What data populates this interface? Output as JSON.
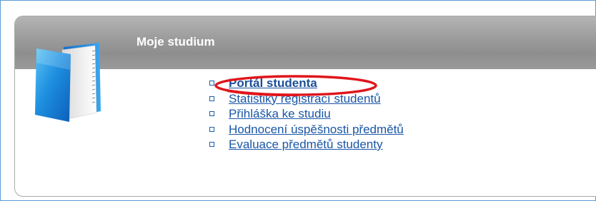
{
  "panel": {
    "title": "Moje studium",
    "icon": "book-icon"
  },
  "links": [
    {
      "label": "Portál studenta",
      "highlighted": true
    },
    {
      "label": "Statistiky registrací studentů",
      "highlighted": false
    },
    {
      "label": "Přihláška ke studiu",
      "highlighted": false
    },
    {
      "label": "Hodnocení úspěšnosti předmětů",
      "highlighted": false
    },
    {
      "label": "Evaluace předmětů studenty",
      "highlighted": false
    }
  ],
  "colors": {
    "link": "#1a56a8",
    "header_gray": "#9d9d9d",
    "highlight_oval": "#e0151b",
    "frame_border": "#5b9bd5"
  }
}
